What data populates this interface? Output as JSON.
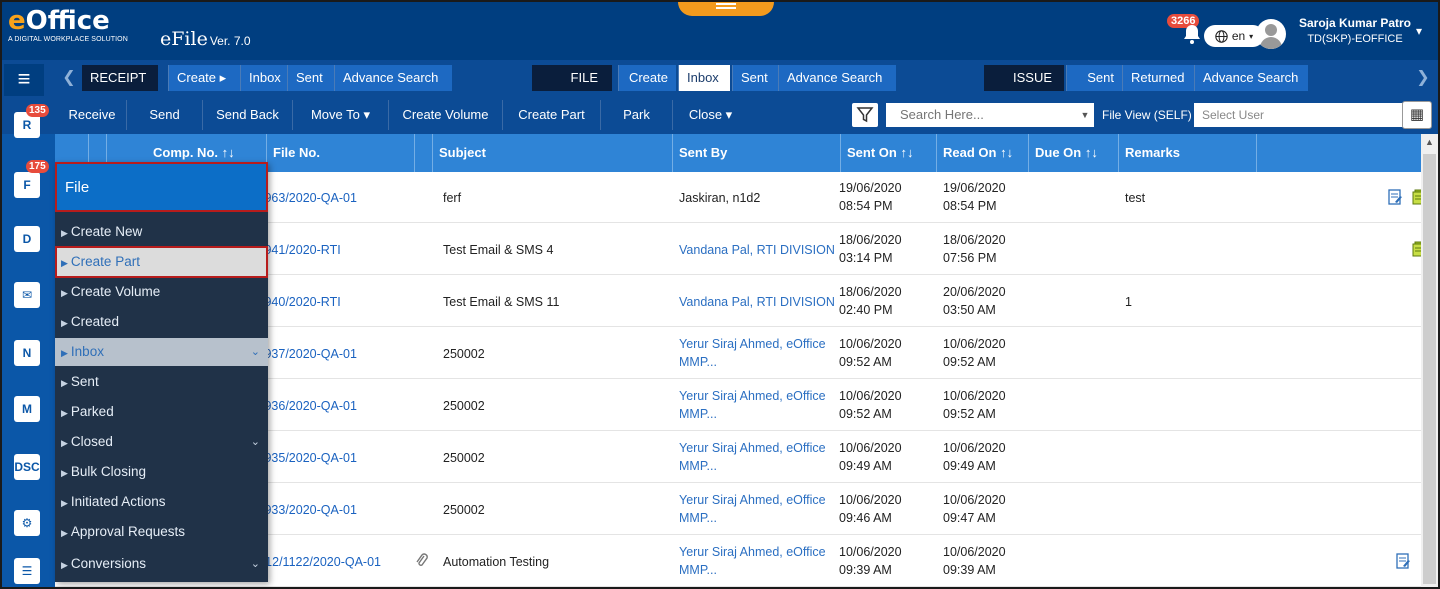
{
  "app": {
    "brand_e": "e",
    "brand_rest": "Office",
    "tagline": "A DIGITAL WORKPLACE SOLUTION",
    "title": "eFile",
    "version": "Ver. 7.0"
  },
  "header": {
    "notification_count": "3266",
    "language": "en",
    "user_name": "Saroja Kumar Patro",
    "user_role": "TD(SKP)-EOFFICE"
  },
  "modules": {
    "receipt": {
      "label": "RECEIPT",
      "create": "Create ▸",
      "inbox": "Inbox",
      "sent": "Sent",
      "advance": "Advance Search"
    },
    "file": {
      "label": "FILE",
      "create": "Create",
      "inbox": "Inbox",
      "sent": "Sent",
      "advance": "Advance Search"
    },
    "issue": {
      "label": "ISSUE",
      "sent": "Sent",
      "returned": "Returned",
      "advance": "Advance Search"
    }
  },
  "toolbar": {
    "receive": "Receive",
    "send": "Send",
    "send_back": "Send Back",
    "move_to": "Move To ▾",
    "create_volume": "Create Volume",
    "create_part": "Create Part",
    "park": "Park",
    "close": "Close ▾",
    "search_placeholder": "Search Here...",
    "file_view": "File View (SELF)",
    "select_user": "Select User"
  },
  "sidebar": {
    "badge_receipt": "135",
    "badge_file": "175"
  },
  "table": {
    "columns": {
      "comp_no": "Comp. No. ↑↓",
      "file_no": "File No.",
      "subject": "Subject",
      "sent_by": "Sent By",
      "sent_on": "Sent On ↑↓",
      "read_on": "Read On ↑↓",
      "due_on": "Due On ↑↓",
      "remarks": "Remarks"
    },
    "rows": [
      {
        "file_no": "/963/2020-QA-01",
        "subject": "ferf",
        "sent_by_1": "Jaskiran, n1d2",
        "sent_by_2": "",
        "sent_date": "19/06/2020",
        "sent_time": "08:54 PM",
        "read_date": "19/06/2020",
        "read_time": "08:54 PM",
        "remarks": "test"
      },
      {
        "file_no": "/941/2020-RTI",
        "subject": "Test Email & SMS 4",
        "sent_by_1": "Vandana Pal, RTI DIVISION",
        "sent_by_2": "",
        "sent_date": "18/06/2020",
        "sent_time": "03:14 PM",
        "read_date": "18/06/2020",
        "read_time": "07:56 PM",
        "remarks": ""
      },
      {
        "file_no": "/940/2020-RTI",
        "subject": "Test Email & SMS 11",
        "sent_by_1": "Vandana Pal, RTI DIVISION",
        "sent_by_2": "",
        "sent_date": "18/06/2020",
        "sent_time": "02:40 PM",
        "read_date": "20/06/2020",
        "read_time": "03:50 AM",
        "remarks": "1"
      },
      {
        "file_no": "/937/2020-QA-01",
        "subject": "250002",
        "sent_by_1": "Yerur Siraj Ahmed, eOffice",
        "sent_by_2": "MMP...",
        "sent_date": "10/06/2020",
        "sent_time": "09:52 AM",
        "read_date": "10/06/2020",
        "read_time": "09:52 AM",
        "remarks": ""
      },
      {
        "file_no": "/936/2020-QA-01",
        "subject": "250002",
        "sent_by_1": "Yerur Siraj Ahmed, eOffice",
        "sent_by_2": "MMP...",
        "sent_date": "10/06/2020",
        "sent_time": "09:52 AM",
        "read_date": "10/06/2020",
        "read_time": "09:52 AM",
        "remarks": ""
      },
      {
        "file_no": "/935/2020-QA-01",
        "subject": "250002",
        "sent_by_1": "Yerur Siraj Ahmed, eOffice",
        "sent_by_2": "MMP...",
        "sent_date": "10/06/2020",
        "sent_time": "09:49 AM",
        "read_date": "10/06/2020",
        "read_time": "09:49 AM",
        "remarks": ""
      },
      {
        "file_no": "/933/2020-QA-01",
        "subject": "250002",
        "sent_by_1": "Yerur Siraj Ahmed, eOffice",
        "sent_by_2": "MMP...",
        "sent_date": "10/06/2020",
        "sent_time": "09:46 AM",
        "read_date": "10/06/2020",
        "read_time": "09:47 AM",
        "remarks": ""
      },
      {
        "file_no": "-12/1122/2020-QA-01",
        "subject": "Automation Testing",
        "sent_by_1": "Yerur Siraj Ahmed, eOffice",
        "sent_by_2": "MMP...",
        "sent_date": "10/06/2020",
        "sent_time": "09:39 AM",
        "read_date": "10/06/2020",
        "read_time": "09:39 AM",
        "remarks": ""
      }
    ]
  },
  "menu": {
    "title": "File",
    "items": [
      "Create New",
      "Create Part",
      "Create Volume",
      "Created",
      "Inbox",
      "Sent",
      "Parked",
      "Closed",
      "Bulk Closing",
      "Initiated Actions",
      "Approval Requests",
      "Conversions"
    ]
  },
  "colors": {
    "header_bg": "#003e80",
    "accent_blue": "#2f84d6",
    "menu_bg": "#203248",
    "highlight_border": "#b71c1c"
  }
}
